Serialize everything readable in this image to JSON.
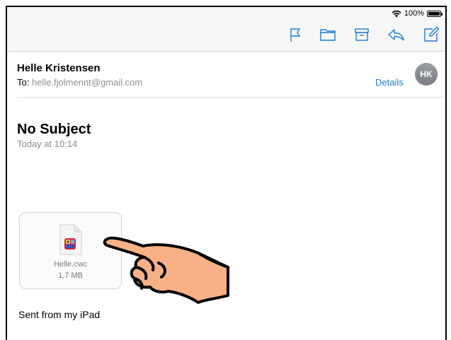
{
  "status_bar": {
    "battery_text": "100%"
  },
  "toolbar": {
    "icons": [
      "flag-icon",
      "folder-icon",
      "archive-icon",
      "reply-icon",
      "compose-icon"
    ]
  },
  "header": {
    "sender_name": "Helle Kristensen",
    "to_label": "To:",
    "to_address": "helle.fjolmennt@gmail.com",
    "details_label": "Details",
    "avatar_initials": "HK"
  },
  "message": {
    "subject": "No Subject",
    "date": "Today at 10:14",
    "attachment": {
      "file_name": "Helle.cwc",
      "file_size": "1,7 MB"
    },
    "body": "Sent from my iPad"
  },
  "colors": {
    "accent": "#1e7ad9",
    "secondary_text": "#8e8e93",
    "bar_background": "#f7f7f7",
    "hand_fill": "#f8b086"
  }
}
